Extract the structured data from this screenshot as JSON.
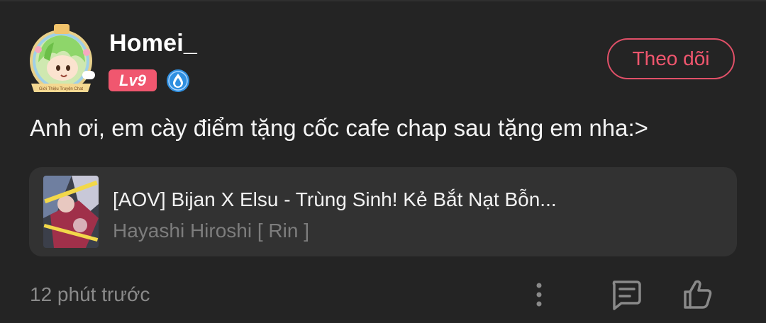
{
  "comment": {
    "username": "Homei_",
    "level": "Lv9",
    "follow_label": "Theo dõi",
    "text": "Anh ơi, em cày điểm tặng cốc cafe chap sau tặng em nha:>",
    "timestamp": "12 phút trước",
    "avatar_frame_caption": "Giới Thiệu Truyện Chat"
  },
  "story": {
    "title": "[AOV] Bijan X Elsu - Trùng Sinh! Kẻ Bắt Nạt Bỗn...",
    "author": "Hayashi Hiroshi [ Rin ]"
  },
  "icons": {
    "badge": "water-drop-icon",
    "more": "more-vertical-icon",
    "reply": "comment-icon",
    "like": "thumbs-up-icon"
  },
  "colors": {
    "background": "#242424",
    "card": "#323232",
    "accent": "#f0566e",
    "muted_text": "#8a8a8a",
    "badge_blue": "#2f8fe0"
  }
}
